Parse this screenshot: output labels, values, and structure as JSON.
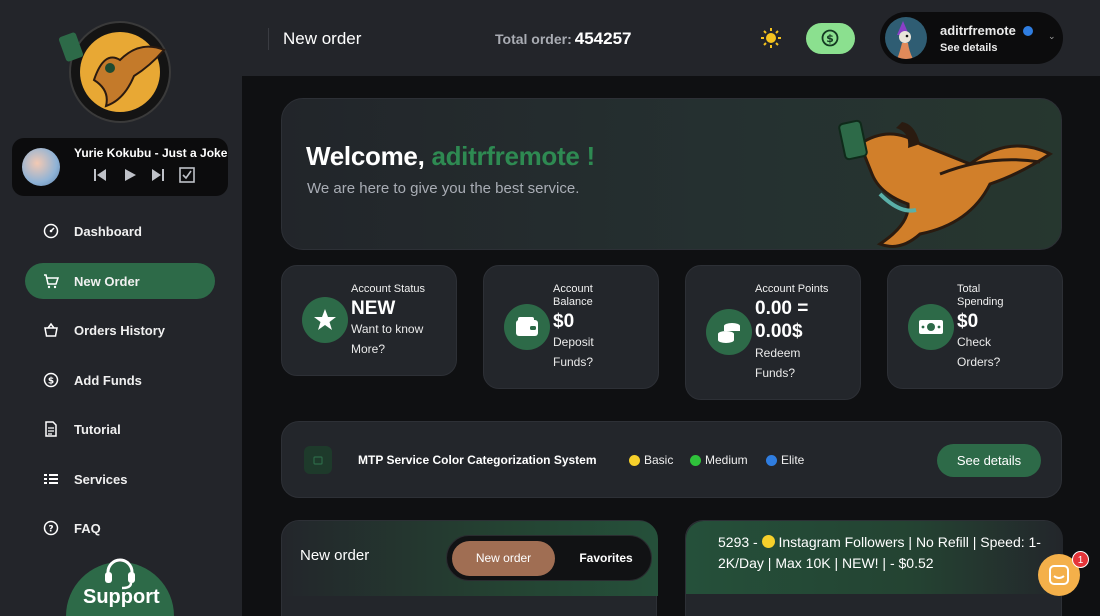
{
  "sidebar": {
    "player": {
      "track": "Yurie Kokubu - Just a Joke"
    },
    "nav": [
      {
        "label": "Dashboard",
        "icon": "dashboard-icon"
      },
      {
        "label": "New Order",
        "icon": "cart-icon",
        "active": true
      },
      {
        "label": "Orders History",
        "icon": "basket-icon"
      },
      {
        "label": "Add Funds",
        "icon": "dollar-circle-icon"
      },
      {
        "label": "Tutorial",
        "icon": "document-icon"
      },
      {
        "label": "Services",
        "icon": "list-icon"
      },
      {
        "label": "FAQ",
        "icon": "question-icon"
      }
    ],
    "support_label": "Support"
  },
  "header": {
    "title": "New order",
    "total_label": "Total order:",
    "total_value": "454257",
    "user": {
      "name": "aditrfremote",
      "sub": "See details"
    }
  },
  "welcome": {
    "greeting": "Welcome,",
    "username": "aditrfremote !",
    "subtitle": "We are here to give you the best service."
  },
  "stats": [
    {
      "title": "Account Status",
      "value": "NEW",
      "link": "Want to know More?"
    },
    {
      "title": "Account Balance",
      "value": "$0",
      "link": "Deposit Funds?"
    },
    {
      "title": "Account Points",
      "value": "0.00 = 0.00$",
      "link": "Redeem Funds?"
    },
    {
      "title": "Total Spending",
      "value": "$0",
      "link": "Check Orders?"
    }
  ],
  "legend": {
    "title": "MTP Service Color Categorization System",
    "items": [
      {
        "label": "Basic",
        "color": "#f6d02b"
      },
      {
        "label": "Medium",
        "color": "#2fc23b"
      },
      {
        "label": "Elite",
        "color": "#2f7de0"
      }
    ],
    "button": "See details"
  },
  "order": {
    "title": "New order",
    "tab_new": "New order",
    "tab_fav": "Favorites"
  },
  "service": {
    "prefix": "5293 -",
    "text": "Instagram Followers | No Refill | Speed: 1-2K/Day | Max 10K | NEW! | - $0.52"
  },
  "chat": {
    "badge": "1"
  },
  "colors": {
    "accent": "#2d6a48",
    "brand_green": "#2e8a52",
    "funds_button": "#8be08f",
    "tab_active": "#a06e53",
    "chat": "#f4b04a"
  }
}
